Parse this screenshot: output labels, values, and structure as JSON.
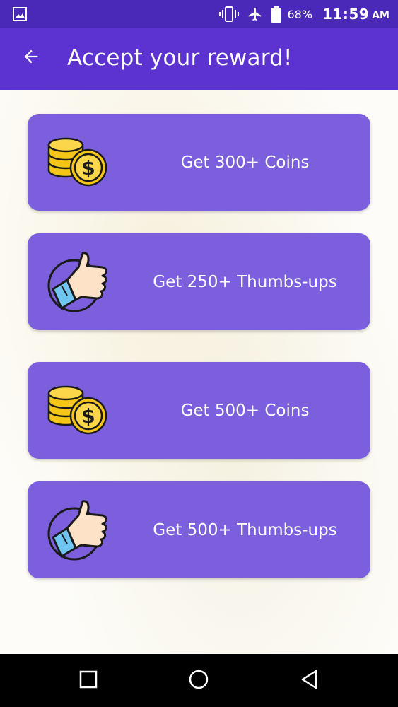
{
  "status_bar": {
    "battery_percent": "68%",
    "time": "11:59",
    "ampm": "AM",
    "icons": [
      "gallery-icon",
      "vibrate-icon",
      "airplane-icon",
      "battery-icon"
    ]
  },
  "app_bar": {
    "title": "Accept your reward!",
    "back_icon": "arrow-left-icon"
  },
  "rewards": [
    {
      "label": "Get 300+ Coins",
      "icon": "coins-icon"
    },
    {
      "label": "Get 250+ Thumbs-ups",
      "icon": "thumbs-up-icon"
    },
    {
      "label": "Get 500+ Coins",
      "icon": "coins-icon"
    },
    {
      "label": "Get 500+ Thumbs-ups",
      "icon": "thumbs-up-icon"
    }
  ],
  "nav_bar": {
    "icons": [
      "recent-apps-icon",
      "home-icon",
      "back-nav-icon"
    ]
  },
  "colors": {
    "status_bar": "#4a28b8",
    "app_bar": "#5c33d0",
    "card": "#7b5fdc",
    "nav_bar": "#000000"
  }
}
